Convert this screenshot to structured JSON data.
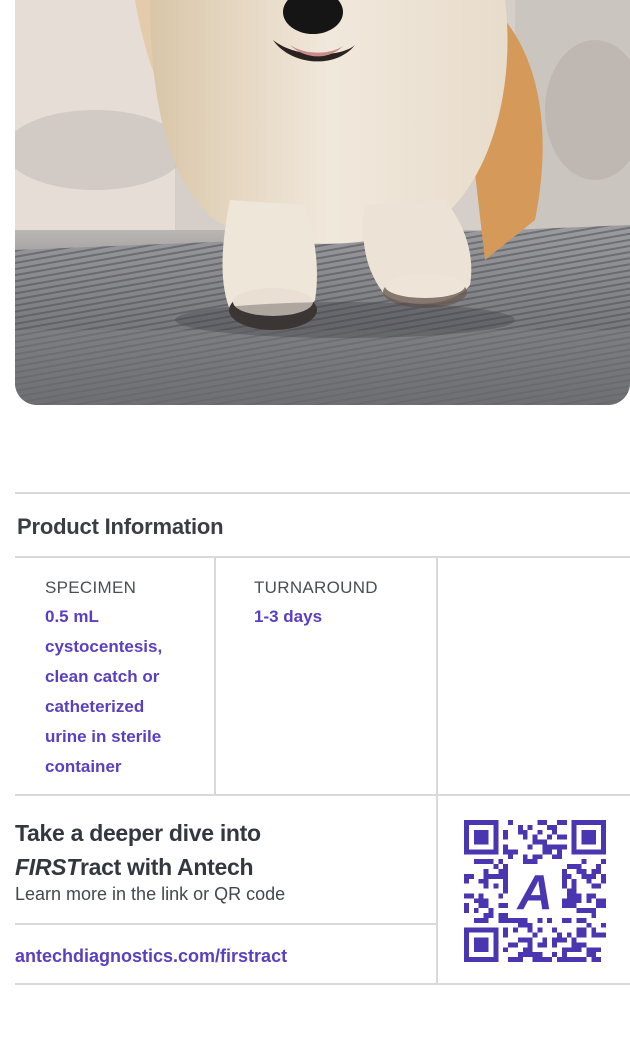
{
  "product_info": {
    "title": "Product Information",
    "specimen": {
      "label": "SPECIMEN",
      "lines": [
        "0.5 mL",
        "cystocentesis,",
        "clean catch or",
        "catheterized",
        "urine in sterile",
        "container"
      ]
    },
    "turnaround": {
      "label": "TURNAROUND",
      "value": "1-3 days"
    }
  },
  "cta": {
    "title_line1": "Take a deeper dive into",
    "title_line2_em": "FIRST",
    "title_line2_rest": "ract with Antech",
    "subtitle": "Learn more in the link or QR code",
    "link": "antechdiagnostics.com/firstract",
    "qr_center_letter": "A"
  },
  "colors": {
    "accent": "#5a3fc0",
    "divider": "#d9d9d9",
    "text": "#333840"
  }
}
